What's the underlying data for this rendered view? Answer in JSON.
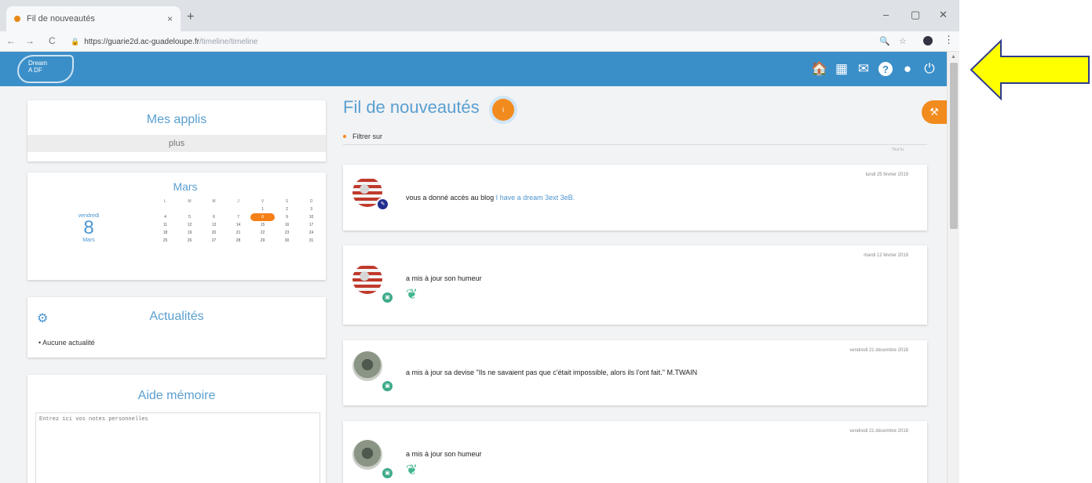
{
  "browser": {
    "tab_title": "Fil de nouveautés",
    "tab_close": "×",
    "new_tab": "+",
    "window_controls": [
      "–",
      "▢",
      "✕"
    ],
    "url_host": "https://guarie2d.ac-guadeloupe.fr",
    "url_path": "/timeline/timeline",
    "nav": {
      "back": "←",
      "forward": "→",
      "reload": "C"
    },
    "ext_icons": [
      "🔍",
      "☆"
    ],
    "menu": "⋮"
  },
  "topnav": {
    "logo_line1": "Dream",
    "logo_line2": "A  DF",
    "icons": [
      {
        "name": "home-icon",
        "glyph": "🏠"
      },
      {
        "name": "apps-grid-icon",
        "glyph": "▦"
      },
      {
        "name": "mail-icon",
        "glyph": "✉"
      },
      {
        "name": "help-icon",
        "glyph": "?"
      },
      {
        "name": "account-icon",
        "glyph": "●"
      },
      {
        "name": "power-icon",
        "glyph": "⏻"
      }
    ]
  },
  "apps": {
    "title": "Mes applis",
    "more": "plus"
  },
  "calendar": {
    "day_name": "vendredi",
    "day_number": "8",
    "month_short": "Mars",
    "month_title": "Mars",
    "weekdays": [
      "L",
      "M",
      "M",
      "J",
      "V",
      "S",
      "D"
    ],
    "weeks": [
      [
        "",
        "",
        "",
        "",
        "1",
        "2",
        "3"
      ],
      [
        "4",
        "5",
        "6",
        "7",
        "8",
        "9",
        "10"
      ],
      [
        "11",
        "12",
        "13",
        "14",
        "15",
        "16",
        "17"
      ],
      [
        "18",
        "19",
        "20",
        "21",
        "22",
        "23",
        "24"
      ],
      [
        "25",
        "26",
        "27",
        "28",
        "29",
        "30",
        "31"
      ]
    ],
    "selected": "8"
  },
  "news": {
    "title": "Actualités",
    "empty": "Aucune actualité"
  },
  "memo": {
    "title": "Aide mémoire",
    "placeholder": "Entrez ici vos notes personnelles"
  },
  "feed": {
    "title": "Fil de nouveautés",
    "badge": "i",
    "tools": "⚒",
    "filter": "Filtrer sur",
    "mark_all": "Tout lu",
    "posts": [
      {
        "date": "lundi 25 février 2019",
        "text": "vous a donné accès au blog",
        "link": "I have a dream 3ext 3eB.",
        "avatar": "flag",
        "badge": "blog",
        "badge_glyph": "✎"
      },
      {
        "date": "mardi 12 février 2019",
        "text": "a mis à jour son humeur",
        "avatar": "flag",
        "badge": "mood",
        "badge_glyph": "▣",
        "leaf": "❦"
      },
      {
        "date": "vendredi 21 décembre 2018",
        "text": "a mis à jour sa devise \"Ils ne savaient pas que c'était impossible, alors ils l'ont fait.\" M.TWAIN",
        "avatar": "plant",
        "badge": "mood",
        "badge_glyph": "▣"
      },
      {
        "date": "vendredi 21 décembre 2018",
        "text": "a mis à jour son humeur",
        "avatar": "plant",
        "badge": "mood",
        "badge_glyph": "▣",
        "leaf": "❦"
      }
    ]
  },
  "colors": {
    "topnav": "#3b8fc9",
    "accent_orange": "#f28b1e",
    "title_blue": "#5a9fd0",
    "arrow_fill": "#ffff00",
    "arrow_stroke": "#2f3b8c"
  }
}
